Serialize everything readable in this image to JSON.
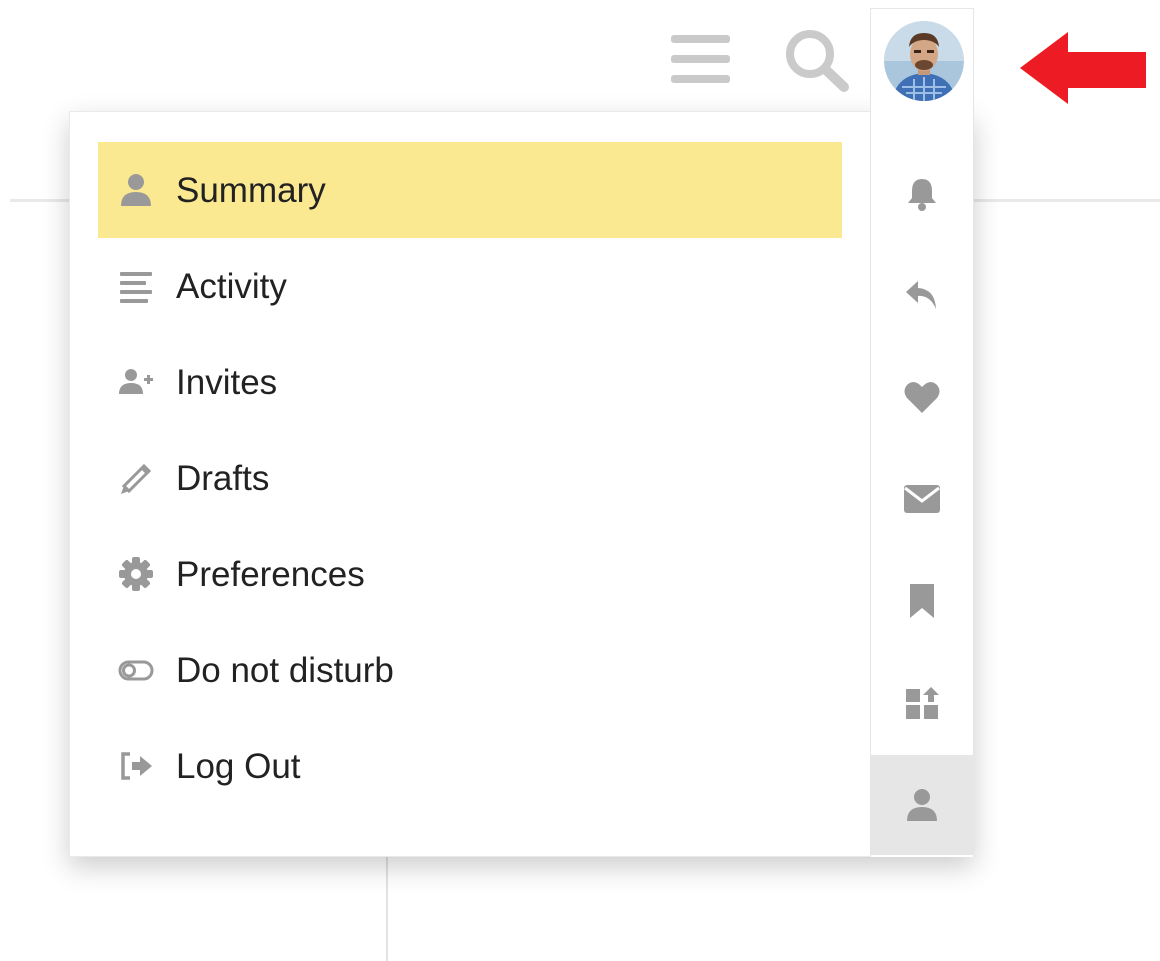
{
  "header": {
    "menu_icon": "hamburger-icon",
    "search_icon": "search-icon",
    "avatar_icon": "user-avatar"
  },
  "annotation": {
    "icon": "red-arrow-left",
    "color": "#ed1c24"
  },
  "user_menu": {
    "items": [
      {
        "label": "Summary",
        "icon": "user-icon",
        "selected": true
      },
      {
        "label": "Activity",
        "icon": "stream-icon",
        "selected": false
      },
      {
        "label": "Invites",
        "icon": "user-plus-icon",
        "selected": false
      },
      {
        "label": "Drafts",
        "icon": "pencil-icon",
        "selected": false
      },
      {
        "label": "Preferences",
        "icon": "gear-icon",
        "selected": false
      },
      {
        "label": "Do not disturb",
        "icon": "toggle-off-icon",
        "selected": false
      },
      {
        "label": "Log Out",
        "icon": "sign-out-icon",
        "selected": false
      }
    ],
    "highlight_color": "#fbe991"
  },
  "quick_access": {
    "tabs": [
      {
        "icon": "bell-icon",
        "active": false
      },
      {
        "icon": "reply-icon",
        "active": false
      },
      {
        "icon": "heart-icon",
        "active": false
      },
      {
        "icon": "envelope-icon",
        "active": false
      },
      {
        "icon": "bookmark-icon",
        "active": false
      },
      {
        "icon": "review-icon",
        "active": false
      },
      {
        "icon": "user-icon",
        "active": true
      }
    ]
  },
  "colors": {
    "icon_gray": "#999999",
    "text": "#222222",
    "header_icon": "#cacaca"
  }
}
